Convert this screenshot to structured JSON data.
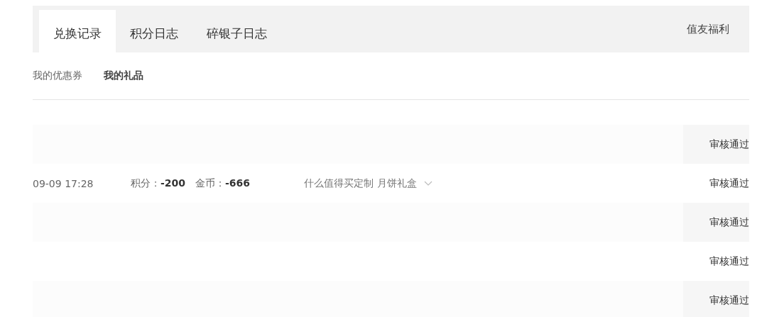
{
  "tabs": [
    {
      "label": "兑换记录",
      "selected": true
    },
    {
      "label": "积分日志",
      "selected": false
    },
    {
      "label": "碎银子日志",
      "selected": false
    }
  ],
  "tab_bar_link": "值友福利",
  "subtabs": [
    {
      "label": "我的优惠券",
      "selected": false
    },
    {
      "label": "我的礼品",
      "selected": true
    }
  ],
  "rows": [
    {
      "status": "审核通过"
    },
    {
      "time": "09-09 17:28",
      "points": "积分：**-200**",
      "coins": "金币：**-666**",
      "item": "什么值得买定制 月饼礼盒",
      "expanded": false,
      "status": "审核通过"
    },
    {
      "status": "审核通过"
    },
    {
      "status": "审核通过"
    },
    {
      "status": "审核通过"
    }
  ]
}
